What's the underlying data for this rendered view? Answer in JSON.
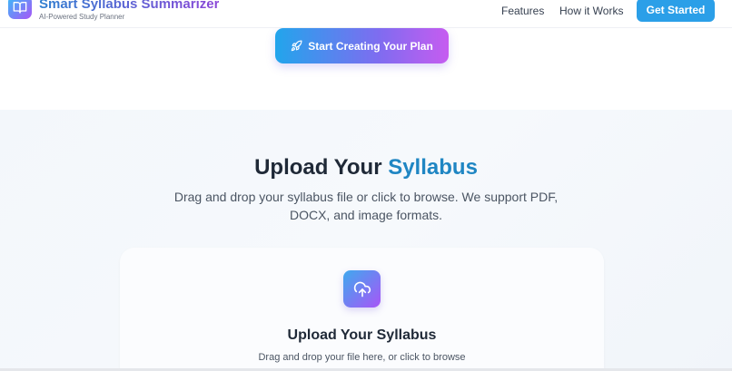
{
  "header": {
    "brand_title": "Smart Syllabus Summarizer",
    "brand_subtitle": "AI-Powered Study Planner",
    "logo_icon": "book-icon",
    "nav": {
      "features": "Features",
      "how_it_works": "How it Works"
    },
    "get_started": "Get Started"
  },
  "hero": {
    "cta_label": "Start Creating Your Plan",
    "cta_icon": "rocket-icon"
  },
  "upload_section": {
    "title_prefix": "Upload Your",
    "title_accent": "Syllabus",
    "description": "Drag and drop your syllabus file or click to browse. We support PDF, DOCX, and image formats.",
    "card": {
      "icon": "cloud-upload-icon",
      "title": "Upload Your Syllabus",
      "subtitle": "Drag and drop your file here, or click to browse"
    }
  },
  "colors": {
    "accent_blue": "#1f86c3",
    "button_blue": "#2b9fe8",
    "gradient_start": "#22a5ec",
    "gradient_end": "#c65cf0"
  }
}
